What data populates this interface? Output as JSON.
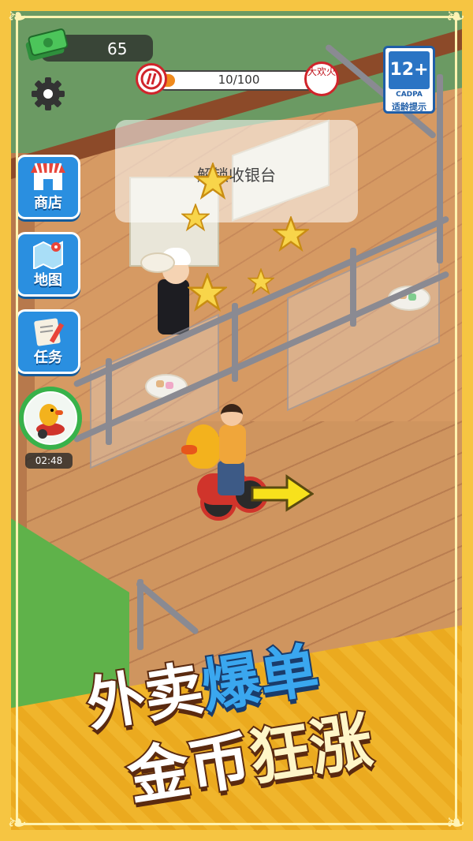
{
  "hud": {
    "money": "65",
    "progress_text": "10/100",
    "progress_fraction": 0.1,
    "brand_badge": "大欢火",
    "age_rating": {
      "rating": "12+",
      "org": "CADPA",
      "label": "适龄提示"
    }
  },
  "sidebar": {
    "shop_label": "商店",
    "map_label": "地图",
    "task_label": "任务",
    "timer": "02:48"
  },
  "world": {
    "unlock_text": "解锁收银台"
  },
  "banner": {
    "line1_white": "外卖",
    "line1_blue": "爆单",
    "line2_white": "金币",
    "line2_yellow": "狂涨"
  },
  "colors": {
    "accent_orange": "#f08a1c",
    "button_blue": "#2a8fe0",
    "timer_green": "#38b24a",
    "banner_gold": "#f0b52c"
  }
}
